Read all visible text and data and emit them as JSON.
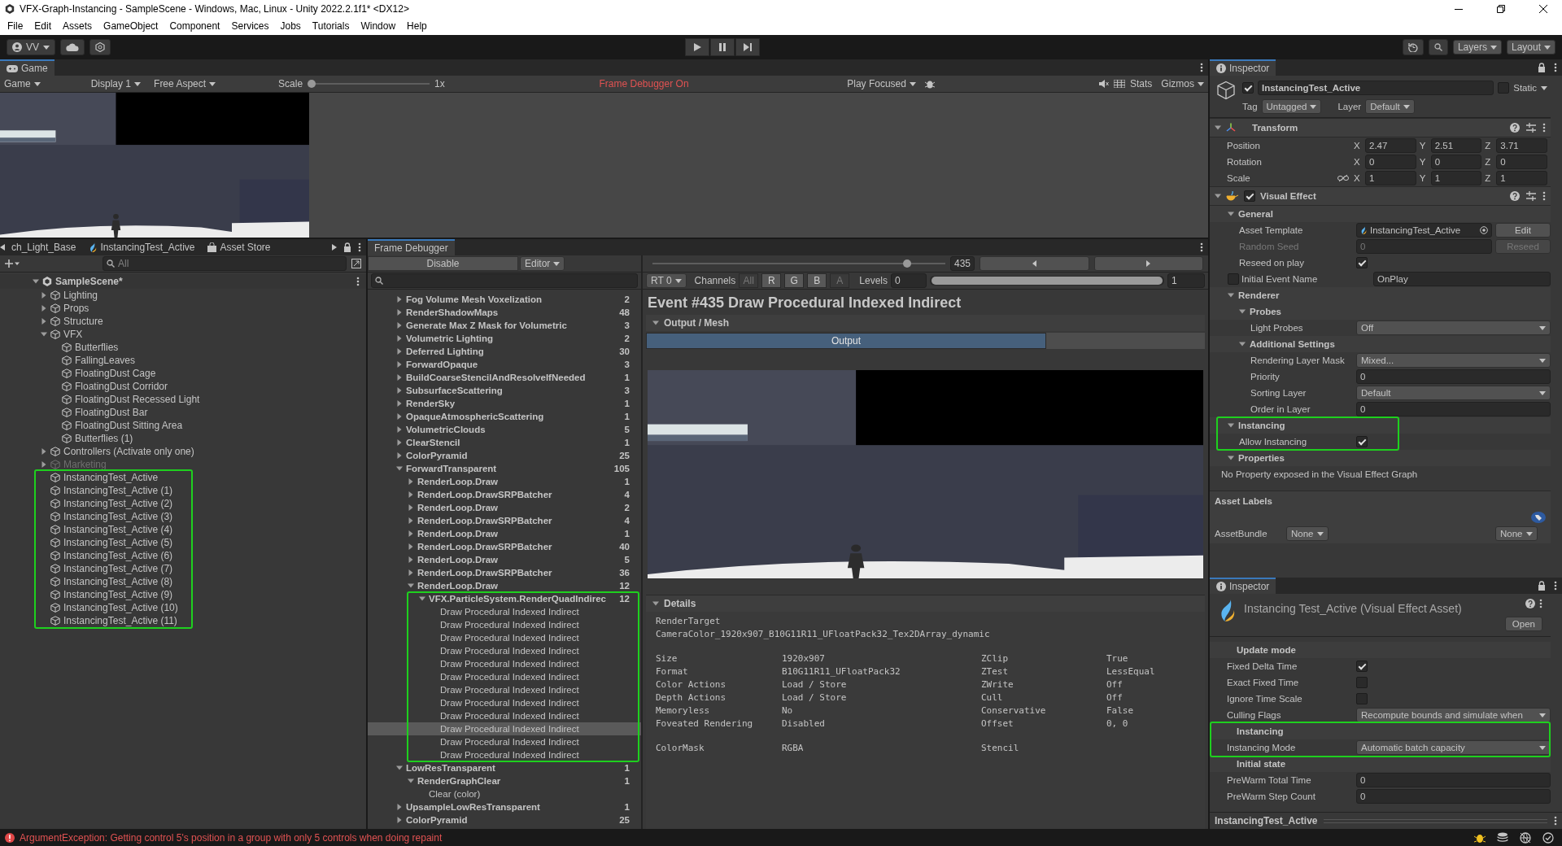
{
  "window": {
    "title": "VFX-Graph-Instancing - SampleScene - Windows, Mac, Linux - Unity 2022.2.1f1* <DX12>"
  },
  "menu": [
    "File",
    "Edit",
    "Assets",
    "GameObject",
    "Component",
    "Services",
    "Jobs",
    "Tutorials",
    "Window",
    "Help"
  ],
  "toolbar": {
    "account": "VV",
    "layers": "Layers",
    "layout": "Layout"
  },
  "game": {
    "tab": "Game",
    "view": "Game",
    "display": "Display 1",
    "aspect": "Free Aspect",
    "scale_label": "Scale",
    "scale_slider": {
      "level": 0
    },
    "scale": "1x",
    "notice": "Frame Debugger On",
    "play_mode": "Play Focused",
    "stats": "Stats",
    "gizmos": "Gizmos"
  },
  "hierarchy": {
    "tabs": [
      {
        "label": "ch_Light_Base",
        "kind": "plain"
      },
      {
        "label": "InstancingTest_Active",
        "kind": "vfx"
      },
      {
        "label": "Asset Store",
        "kind": "store"
      }
    ],
    "search": {
      "placeholder": "All"
    },
    "scene": {
      "label": "SampleScene*",
      "expanded": true,
      "children": [
        {
          "label": "Lighting",
          "expanded": false,
          "disabled": false
        },
        {
          "label": "Props",
          "expanded": false,
          "disabled": false
        },
        {
          "label": "Structure",
          "expanded": false,
          "disabled": false
        },
        {
          "label": "VFX",
          "expanded": true,
          "disabled": false,
          "children": [
            {
              "label": "Butterflies"
            },
            {
              "label": "FallingLeaves"
            },
            {
              "label": "FloatingDust Cage"
            },
            {
              "label": "FloatingDust Corridor"
            },
            {
              "label": "FloatingDust Recessed Light"
            },
            {
              "label": "FloatingDust Bar"
            },
            {
              "label": "FloatingDust Sitting Area"
            },
            {
              "label": "Butterflies (1)"
            }
          ]
        },
        {
          "label": "Controllers (Activate only one)",
          "expanded": false,
          "disabled": false
        },
        {
          "label": "Marketing",
          "expanded": false,
          "disabled": true
        }
      ],
      "framed_children": [
        {
          "label": "InstancingTest_Active"
        },
        {
          "label": "InstancingTest_Active (1)"
        },
        {
          "label": "InstancingTest_Active (2)"
        },
        {
          "label": "InstancingTest_Active (3)"
        },
        {
          "label": "InstancingTest_Active (4)"
        },
        {
          "label": "InstancingTest_Active (5)"
        },
        {
          "label": "InstancingTest_Active (6)"
        },
        {
          "label": "InstancingTest_Active (7)"
        },
        {
          "label": "InstancingTest_Active (8)"
        },
        {
          "label": "InstancingTest_Active (9)"
        },
        {
          "label": "InstancingTest_Active (10)"
        },
        {
          "label": "InstancingTest_Active (11)"
        }
      ]
    }
  },
  "frame_debugger": {
    "tab": "Frame Debugger",
    "disable": "Disable",
    "target": "Editor",
    "event_slider": {
      "level": 0.87
    },
    "event": "435",
    "rt": "RT 0",
    "channels_label": "Channels",
    "channels": [
      {
        "label": "All",
        "selected": false
      },
      {
        "label": "R",
        "selected": true
      },
      {
        "label": "G",
        "selected": true
      },
      {
        "label": "B",
        "selected": true
      },
      {
        "label": "A",
        "selected": false
      }
    ],
    "levels_label": "Levels",
    "levels_min": "0",
    "levels_range": {
      "level": 1
    },
    "levels_max": "1",
    "events": [
      {
        "label": "Fog Volume Mesh Voxelization",
        "count": "2",
        "expanded": false
      },
      {
        "label": "RenderShadowMaps",
        "count": "48",
        "expanded": false
      },
      {
        "label": "Generate Max Z Mask for Volumetric",
        "count": "3",
        "expanded": false
      },
      {
        "label": "Volumetric Lighting",
        "count": "2",
        "expanded": false
      },
      {
        "label": "Deferred Lighting",
        "count": "30",
        "expanded": false
      },
      {
        "label": "ForwardOpaque",
        "count": "3",
        "expanded": false
      },
      {
        "label": "BuildCoarseStencilAndResolveIfNeeded",
        "count": "1",
        "expanded": false
      },
      {
        "label": "SubsurfaceScattering",
        "count": "3",
        "expanded": false
      },
      {
        "label": "RenderSky",
        "count": "1",
        "expanded": false
      },
      {
        "label": "OpaqueAtmosphericScattering",
        "count": "1",
        "expanded": false
      },
      {
        "label": "VolumetricClouds",
        "count": "5",
        "expanded": false
      },
      {
        "label": "ClearStencil",
        "count": "1",
        "expanded": false
      },
      {
        "label": "ColorPyramid",
        "count": "25",
        "expanded": false
      },
      {
        "label": "ForwardTransparent",
        "count": "105",
        "expanded": true,
        "children": [
          {
            "label": "RenderLoop.Draw",
            "count": "1",
            "expanded": false
          },
          {
            "label": "RenderLoop.DrawSRPBatcher",
            "count": "4",
            "expanded": false
          },
          {
            "label": "RenderLoop.Draw",
            "count": "2",
            "expanded": false
          },
          {
            "label": "RenderLoop.DrawSRPBatcher",
            "count": "4",
            "expanded": false
          },
          {
            "label": "RenderLoop.Draw",
            "count": "1",
            "expanded": false
          },
          {
            "label": "RenderLoop.DrawSRPBatcher",
            "count": "40",
            "expanded": false
          },
          {
            "label": "RenderLoop.Draw",
            "count": "5",
            "expanded": false
          },
          {
            "label": "RenderLoop.DrawSRPBatcher",
            "count": "36",
            "expanded": false
          },
          {
            "label": "RenderLoop.Draw",
            "count": "12",
            "expanded": true,
            "children": [
              {
                "label": "VFX.ParticleSystem.RenderQuadIndirec",
                "count": "12",
                "expanded": true,
                "highlighted": true,
                "children": [
                  {
                    "label": "Draw Procedural Indexed Indirect",
                    "selected": false
                  },
                  {
                    "label": "Draw Procedural Indexed Indirect",
                    "selected": false
                  },
                  {
                    "label": "Draw Procedural Indexed Indirect",
                    "selected": false
                  },
                  {
                    "label": "Draw Procedural Indexed Indirect",
                    "selected": false
                  },
                  {
                    "label": "Draw Procedural Indexed Indirect",
                    "selected": false
                  },
                  {
                    "label": "Draw Procedural Indexed Indirect",
                    "selected": false
                  },
                  {
                    "label": "Draw Procedural Indexed Indirect",
                    "selected": false
                  },
                  {
                    "label": "Draw Procedural Indexed Indirect",
                    "selected": false
                  },
                  {
                    "label": "Draw Procedural Indexed Indirect",
                    "selected": false
                  },
                  {
                    "label": "Draw Procedural Indexed Indirect",
                    "selected": true
                  },
                  {
                    "label": "Draw Procedural Indexed Indirect",
                    "selected": false
                  },
                  {
                    "label": "Draw Procedural Indexed Indirect",
                    "selected": false
                  }
                ]
              }
            ]
          }
        ]
      },
      {
        "label": "LowResTransparent",
        "count": "1",
        "expanded": true,
        "children": [
          {
            "label": "RenderGraphClear",
            "count": "1",
            "expanded": true,
            "children": [
              {
                "label": "Clear (color)"
              }
            ]
          }
        ]
      },
      {
        "label": "UpsampleLowResTransparent",
        "count": "1",
        "expanded": false
      },
      {
        "label": "ColorPyramid",
        "count": "25",
        "expanded": false
      }
    ],
    "title": "Event #435 Draw Procedural Indexed Indirect",
    "output": {
      "title": "Output / Mesh",
      "expanded": true,
      "tabs": [
        {
          "label": "Output",
          "selected": true
        }
      ]
    },
    "details": {
      "title": "Details",
      "expanded": true,
      "target_label": "RenderTarget",
      "target": "CameraColor_1920x907_B10G11R11_UFloatPack32_Tex2DArray_dynamic",
      "tables": [
        [
          [
            "Size",
            "1920x907",
            "ZClip",
            "True"
          ],
          [
            "Format",
            "B10G11R11_UFloatPack32",
            "ZTest",
            "LessEqual"
          ],
          [
            "Color Actions",
            "Load / Store",
            "ZWrite",
            "Off"
          ],
          [
            "Depth Actions",
            "Load / Store",
            "Cull",
            "Off"
          ],
          [
            "Memoryless",
            "No",
            "Conservative",
            "False"
          ],
          [
            "Foveated Rendering",
            "Disabled",
            "Offset",
            "0, 0"
          ]
        ],
        [
          [
            "ColorMask",
            "RGBA",
            "Stencil"
          ]
        ]
      ]
    }
  },
  "inspector": {
    "tab": "Inspector",
    "object": {
      "active": true,
      "name": "InstancingTest_Active",
      "static": false,
      "static_label": "Static",
      "tag_label": "Tag",
      "tag": "Untagged",
      "layer_label": "Layer",
      "layer": "Default"
    },
    "transform": {
      "title": "Transform",
      "expanded": true,
      "rows": [
        {
          "label": "Position",
          "axes": [
            "X",
            "Y",
            "Z"
          ],
          "values": [
            "2.47",
            "2.51",
            "3.71"
          ]
        },
        {
          "label": "Rotation",
          "axes": [
            "X",
            "Y",
            "Z"
          ],
          "values": [
            "0",
            "0",
            "0"
          ]
        },
        {
          "label": "Scale",
          "constrained": false,
          "axes": [
            "X",
            "Y",
            "Z"
          ],
          "values": [
            "1",
            "1",
            "1"
          ]
        }
      ]
    },
    "visual_effect": {
      "title": "Visual Effect",
      "expanded": true,
      "enabled": true,
      "groups": [
        {
          "title": "General",
          "expanded": true,
          "rows": [
            {
              "kind": "object",
              "label": "Asset Template",
              "value": "InstancingTest_Active",
              "button": "Edit"
            },
            {
              "kind": "field_button",
              "label": "Random Seed",
              "value": "0",
              "button": "Reseed",
              "disabled": true
            },
            {
              "kind": "checkbox",
              "label": "Reseed on play",
              "checked": true
            },
            {
              "kind": "toggle_field",
              "label": "Initial Event Name",
              "checked": false,
              "value": "OnPlay"
            }
          ]
        },
        {
          "title": "Renderer",
          "expanded": true,
          "groups": [
            {
              "title": "Probes",
              "expanded": true,
              "rows": [
                {
                  "kind": "dropdown",
                  "label": "Light Probes",
                  "value": "Off"
                }
              ]
            },
            {
              "title": "Additional Settings",
              "expanded": true,
              "rows": [
                {
                  "kind": "dropdown",
                  "label": "Rendering Layer Mask",
                  "value": "Mixed..."
                },
                {
                  "kind": "field",
                  "label": "Priority",
                  "value": "0"
                },
                {
                  "kind": "dropdown",
                  "label": "Sorting Layer",
                  "value": "Default"
                },
                {
                  "kind": "field",
                  "label": "Order in Layer",
                  "value": "0"
                }
              ]
            }
          ]
        },
        {
          "title": "Instancing",
          "expanded": true,
          "highlighted": true,
          "rows": [
            {
              "kind": "checkbox",
              "label": "Allow Instancing",
              "checked": true
            }
          ]
        },
        {
          "title": "Properties",
          "expanded": true,
          "rows": [
            {
              "kind": "note",
              "label": "No Property exposed in the Visual Effect Graph"
            }
          ]
        }
      ]
    },
    "asset_labels": {
      "title": "Asset Labels",
      "bundle_label": "AssetBundle",
      "bundle": "None",
      "variant": "None"
    }
  },
  "asset_inspector": {
    "tab": "Inspector",
    "title": "Instancing Test_Active (Visual Effect Asset)",
    "button": "Open",
    "groups": [
      {
        "title": "Update mode",
        "rows": [
          {
            "kind": "checkbox",
            "label": "Fixed Delta Time",
            "checked": true
          },
          {
            "kind": "checkbox",
            "label": "Exact Fixed Time",
            "checked": false
          },
          {
            "kind": "checkbox",
            "label": "Ignore Time Scale",
            "checked": false
          },
          {
            "kind": "dropdown",
            "label": "Culling Flags",
            "value": "Recompute bounds and simulate when"
          }
        ]
      },
      {
        "title": "Instancing",
        "highlighted": true,
        "rows": [
          {
            "kind": "dropdown",
            "label": "Instancing Mode",
            "value": "Automatic batch capacity"
          }
        ]
      },
      {
        "title": "Initial state",
        "rows": [
          {
            "kind": "field",
            "label": "PreWarm Total Time",
            "value": "0"
          },
          {
            "kind": "field",
            "label": "PreWarm Step Count",
            "value": "0"
          }
        ]
      }
    ],
    "footer": "InstancingTest_Active"
  },
  "status": {
    "message": "ArgumentException: Getting control 5's position in a group with only 5 controls when doing repaint"
  }
}
